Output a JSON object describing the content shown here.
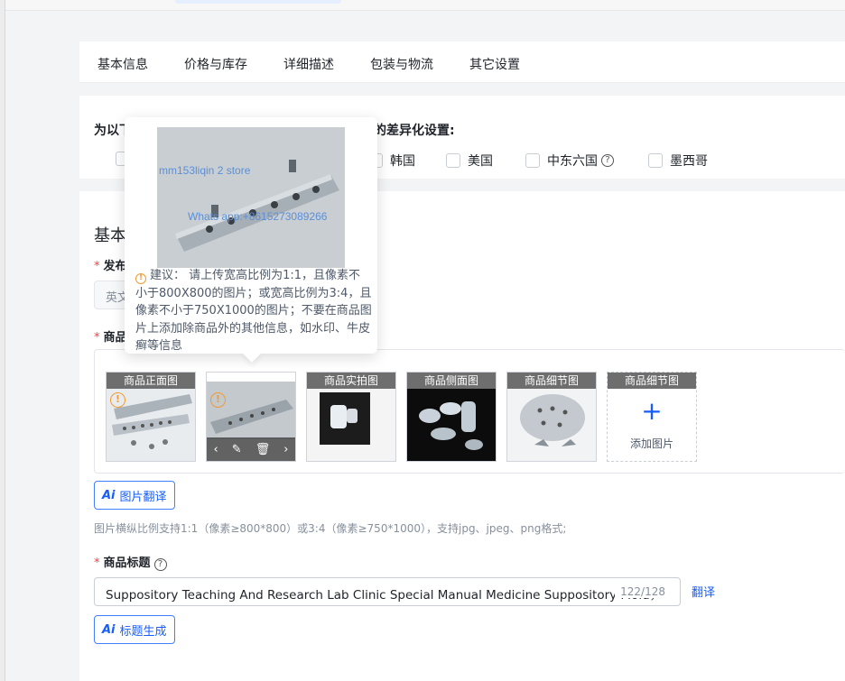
{
  "tabs": [
    "基本信息",
    "价格与库存",
    "详细描述",
    "包装与物流",
    "其它设置"
  ],
  "diff_section": {
    "title_left": "为以下",
    "title_right": "的差异化设置:",
    "countries": [
      "韩国",
      "美国",
      "中东六国",
      "墨西哥"
    ]
  },
  "basic_section": {
    "title": "基本",
    "publish_label": "发布",
    "publish_value": "英文",
    "images_label": "商品"
  },
  "images": {
    "slots": [
      "商品正面图",
      "",
      "商品实拍图",
      "商品侧面图",
      "商品细节图",
      "商品细节图"
    ],
    "add_label": "添加图片",
    "translate_button": "图片翻译",
    "hint": "图片横纵比例支持1:1（像素≥800*800）或3:4（像素≥750*1000），支持jpg、jpeg、png格式;"
  },
  "title_field": {
    "label": "商品标题",
    "value": "Suppository Teaching And Research Lab Clinic Special Manual Medicine Suppository Mold，",
    "count": "122/128",
    "translate": "翻译",
    "generate_button": "标题生成"
  },
  "popover": {
    "watermark1": "mm153liqin 2 store",
    "watermark2": "Whats app:+8615273089266",
    "advice": "建议： 请上传宽高比例为1:1，且像素不小于800X800的图片；或宽高比例为3:4，且像素不小于750X1000的图片；不要在商品图片上添加除商品外的其他信息，如水印、牛皮癣等信息"
  },
  "colors": {
    "primary": "#165dff",
    "required": "#f53f3f",
    "warning": "#f29a33"
  }
}
